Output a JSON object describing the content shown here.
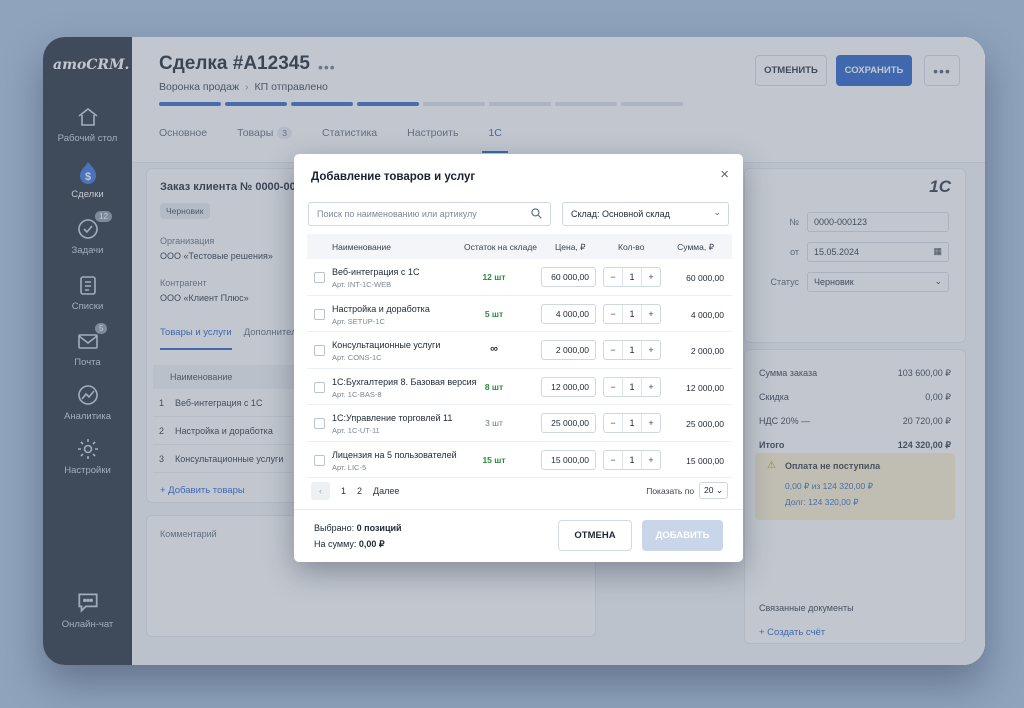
{
  "app": {
    "logo": "amoCRM."
  },
  "sidebar": {
    "items": [
      {
        "label": "Рабочий стол",
        "icon": "home-icon"
      },
      {
        "label": "Сделки",
        "icon": "dollar-icon"
      },
      {
        "label": "Задачи",
        "icon": "check-circle-icon",
        "badge": "12"
      },
      {
        "label": "Списки",
        "icon": "list-icon"
      },
      {
        "label": "Почта",
        "icon": "mail-icon",
        "badge": "5"
      },
      {
        "label": "Аналитика",
        "icon": "chart-line-icon"
      },
      {
        "label": "Настройки",
        "icon": "gear-icon"
      }
    ],
    "chat_label": "Онлайн-чат"
  },
  "header": {
    "title": "Сделка #A12345",
    "breadcrumb": [
      "Воронка продаж",
      "КП отправлено"
    ],
    "progress": {
      "done": 4,
      "total": 8
    },
    "tabs": [
      {
        "label": "Основное"
      },
      {
        "label": "Товары",
        "count": "3"
      },
      {
        "label": "Статистика"
      },
      {
        "label": "Настроить"
      },
      {
        "label": "1С"
      }
    ],
    "cancel_label": "ОТМЕНИТЬ",
    "save_label": "СОХРАНИТЬ"
  },
  "order": {
    "title": "Заказ клиента № 0000-000123",
    "status_pill": "Черновик",
    "org_label": "Организация",
    "org_value": "ООО «Тестовые решения»",
    "contractor_label": "Контрагент",
    "contractor_value": "ООО «Клиент Плюс»",
    "subtabs": [
      "Товары и услуги",
      "Дополнительно"
    ],
    "table_header": "Наименование",
    "rows": [
      {
        "n": "1",
        "name": "Веб-интеграция с 1С"
      },
      {
        "n": "2",
        "name": "Настройка и доработка"
      },
      {
        "n": "3",
        "name": "Консультационные услуги"
      }
    ],
    "add_label": "+ Добавить товары",
    "comment_label": "Комментарий"
  },
  "right": {
    "logo": "1С",
    "number_label": "№",
    "number_value": "0000-000123",
    "date_label": "от",
    "date_value": "15.05.2024",
    "status_label": "Статус",
    "status_value": "Черновик",
    "totals": [
      {
        "label": "Сумма заказа",
        "value": "103 600,00 ₽"
      },
      {
        "label": "Скидка",
        "value": "0,00 ₽"
      },
      {
        "label": "НДС 20% —",
        "value": "20 720,00 ₽"
      },
      {
        "label": "Итого",
        "value": "124 320,00 ₽"
      }
    ],
    "warning_title": "Оплата не поступила",
    "warning_line1": "0,00 ₽ из 124 320,00 ₽",
    "warning_line2": "Долг: 124 320,00 ₽",
    "related_title": "Связанные документы",
    "related_link": "+ Создать счёт"
  },
  "modal": {
    "title": "Добавление товаров и услуг",
    "search_placeholder": "Поиск по наименованию или артикулу",
    "stock_select": "Склад: Основной склад",
    "columns": {
      "name": "Наименование",
      "stock": "Остаток на складе",
      "price": "Цена, ₽",
      "qty": "Кол-во",
      "sum": "Сумма, ₽"
    },
    "rows": [
      {
        "name": "Веб-интеграция с 1С",
        "article": "Арт. INT-1C-WEB",
        "stock": "12 шт",
        "stock_style": "green",
        "price": "60 000,00",
        "qty": "1",
        "sum": "60 000,00"
      },
      {
        "name": "Настройка и доработка",
        "article": "Арт. SETUP-1C",
        "stock": "5 шт",
        "stock_style": "green",
        "price": "4 000,00",
        "qty": "1",
        "sum": "4 000,00"
      },
      {
        "name": "Консультационные услуги",
        "article": "Арт. CONS-1C",
        "stock": "∞",
        "stock_style": "inf",
        "price": "2 000,00",
        "qty": "1",
        "sum": "2 000,00"
      },
      {
        "name": "1С:Бухгалтерия 8. Базовая версия",
        "article": "Арт. 1C-BAS-8",
        "stock": "8 шт",
        "stock_style": "green",
        "price": "12 000,00",
        "qty": "1",
        "sum": "12 000,00"
      },
      {
        "name": "1С:Управление торговлей 11",
        "article": "Арт. 1C-UT-11",
        "stock": "3 шт",
        "stock_style": "grey",
        "price": "25 000,00",
        "qty": "1",
        "sum": "25 000,00"
      },
      {
        "name": "Лицензия на 5 пользователей",
        "article": "Арт. LIC-5",
        "stock": "15 шт",
        "stock_style": "green",
        "price": "15 000,00",
        "qty": "1",
        "sum": "15 000,00"
      }
    ],
    "pager": {
      "prev": "‹",
      "pages": [
        "1",
        "2"
      ],
      "next": "Далее"
    },
    "per_page_label": "Показать по",
    "per_page_value": "20",
    "selected_label": "Выбрано:",
    "selected_value": "0 позиций",
    "sum_label": "На сумму:",
    "sum_value": "0,00 ₽",
    "cancel_label": "ОТМЕНА",
    "add_label": "ДОБАВИТЬ"
  }
}
